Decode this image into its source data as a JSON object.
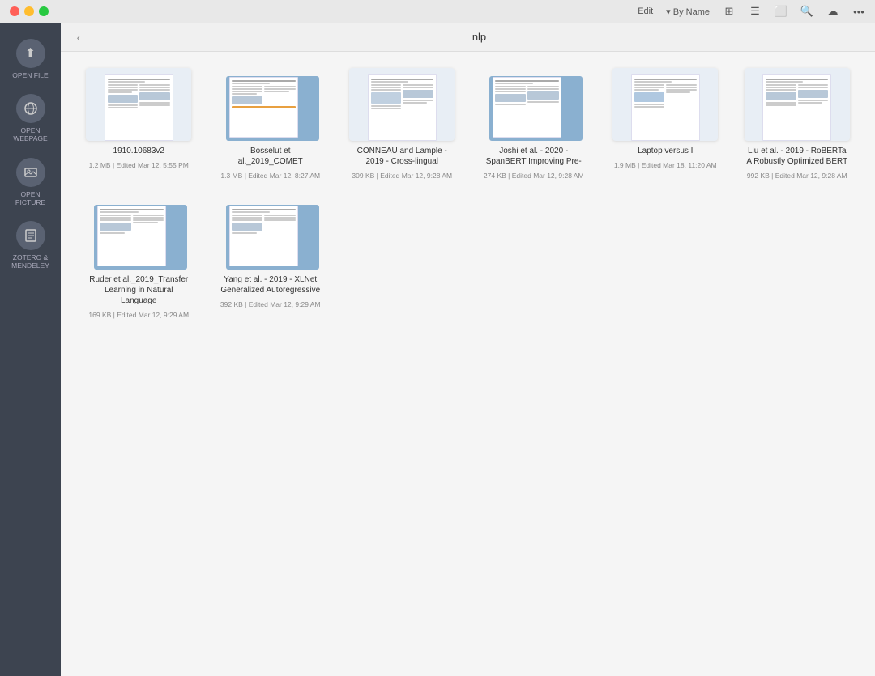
{
  "titlebar": {
    "right_buttons": [
      "Edit",
      "▾ By Name"
    ],
    "icons": [
      "grid-icon",
      "columns-icon",
      "search-icon",
      "cloud-icon",
      "more-icon"
    ]
  },
  "sidebar": {
    "items": [
      {
        "id": "open-file",
        "label": "OPEN FILE",
        "icon": "⬆"
      },
      {
        "id": "open-webpage",
        "label": "OPEN WEBPAGE",
        "icon": "🌐"
      },
      {
        "id": "open-picture",
        "label": "OPEN PICTURE",
        "icon": "🖼"
      },
      {
        "id": "zotero",
        "label": "ZOTERO & MENDELEY",
        "icon": "📄"
      }
    ]
  },
  "toolbar": {
    "back_label": "‹",
    "folder_title": "nlp"
  },
  "files": [
    {
      "id": "f1",
      "name": "1910.10683v2",
      "meta": "1.2 MB | Edited Mar 12, 5:55 PM",
      "type": "plain"
    },
    {
      "id": "f2",
      "name": "Bosselut et al._2019_COMET",
      "meta": "1.3 MB | Edited Mar 12, 8:27 AM",
      "type": "tabbed"
    },
    {
      "id": "f3",
      "name": "CONNEAU and Lample - 2019 - Cross-lingual",
      "meta": "309 KB | Edited Mar 12, 9:28 AM",
      "type": "plain"
    },
    {
      "id": "f4",
      "name": "Joshi et al. - 2020 - SpanBERT Improving Pre-",
      "meta": "274 KB | Edited Mar 12, 9:28 AM",
      "type": "tabbed"
    },
    {
      "id": "f5",
      "name": "Laptop versus I",
      "meta": "1.9 MB | Edited Mar 18, 11:20 AM",
      "type": "plain"
    },
    {
      "id": "f6",
      "name": "Liu et al. - 2019 - RoBERTa A Robustly Optimized BERT",
      "meta": "992 KB | Edited Mar 12, 9:28 AM",
      "type": "plain"
    },
    {
      "id": "f7",
      "name": "Ruder et al._2019_Transfer Learning in Natural Language",
      "meta": "169 KB | Edited Mar 12, 9:29 AM",
      "type": "tabbed"
    },
    {
      "id": "f8",
      "name": "Yang et al. - 2019 - XLNet Generalized Autoregressive",
      "meta": "392 KB | Edited Mar 12, 9:29 AM",
      "type": "tabbed"
    }
  ]
}
